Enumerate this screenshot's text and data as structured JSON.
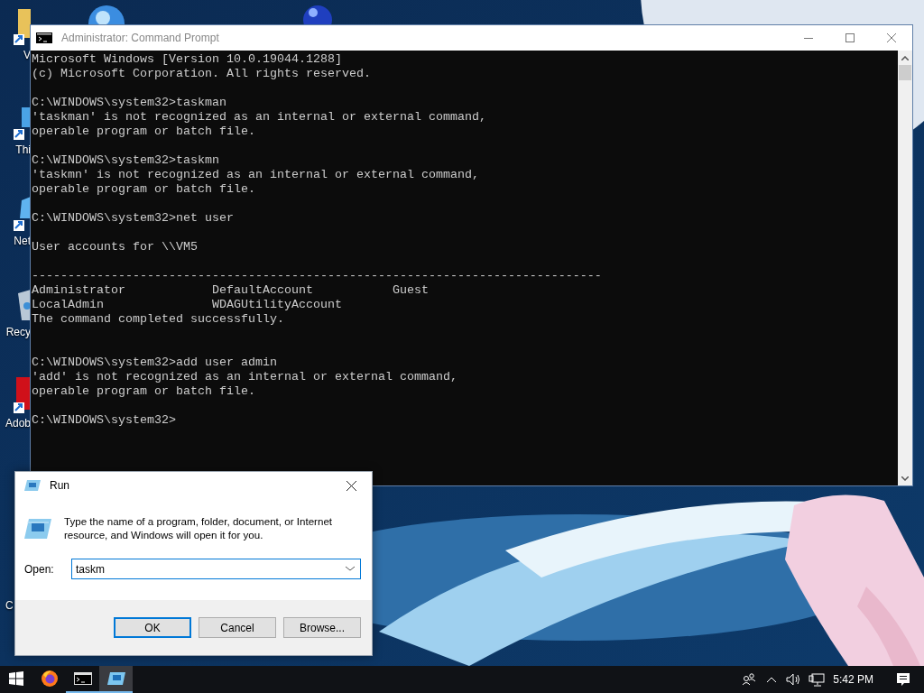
{
  "desktop_icons": [
    {
      "label": "V"
    },
    {
      "label": "Thi"
    },
    {
      "label": "Net"
    },
    {
      "label": "Recy"
    },
    {
      "label": "Adob"
    },
    {
      "label": "C"
    }
  ],
  "console_window": {
    "title": "Administrator: Command Prompt",
    "lines": [
      {
        "kind": "text",
        "text": "Microsoft Windows [Version 10.0.19044.1288]"
      },
      {
        "kind": "text",
        "text": "(c) Microsoft Corporation. All rights reserved."
      },
      {
        "kind": "blank"
      },
      {
        "kind": "text",
        "text": "C:\\WINDOWS\\system32>taskman"
      },
      {
        "kind": "text",
        "text": "'taskman' is not recognized as an internal or external command,"
      },
      {
        "kind": "text",
        "text": "operable program or batch file."
      },
      {
        "kind": "blank"
      },
      {
        "kind": "text",
        "text": "C:\\WINDOWS\\system32>taskmn"
      },
      {
        "kind": "text",
        "text": "'taskmn' is not recognized as an internal or external command,"
      },
      {
        "kind": "text",
        "text": "operable program or batch file."
      },
      {
        "kind": "blank"
      },
      {
        "kind": "text",
        "text": "C:\\WINDOWS\\system32>net user"
      },
      {
        "kind": "blank"
      },
      {
        "kind": "text",
        "text": "User accounts for \\\\VM5"
      },
      {
        "kind": "blank"
      },
      {
        "kind": "text",
        "text": "-------------------------------------------------------------------------------"
      },
      {
        "kind": "text",
        "text": "Administrator            DefaultAccount           Guest"
      },
      {
        "kind": "text",
        "text": "LocalAdmin               WDAGUtilityAccount"
      },
      {
        "kind": "text",
        "text": "The command completed successfully."
      },
      {
        "kind": "blank"
      },
      {
        "kind": "blank"
      },
      {
        "kind": "text",
        "text": "C:\\WINDOWS\\system32>add user admin"
      },
      {
        "kind": "text",
        "text": "'add' is not recognized as an internal or external command,"
      },
      {
        "kind": "text",
        "text": "operable program or batch file."
      },
      {
        "kind": "blank"
      },
      {
        "kind": "text",
        "text": "C:\\WINDOWS\\system32>"
      }
    ]
  },
  "run_dialog": {
    "title": "Run",
    "description": "Type the name of a program, folder, document, or Internet resource, and Windows will open it for you.",
    "open_label": "Open:",
    "open_value": "taskm",
    "buttons": [
      {
        "label": "OK",
        "default": true
      },
      {
        "label": "Cancel",
        "default": false
      },
      {
        "label": "Browse...",
        "default": false
      }
    ]
  },
  "taskbar": {
    "apps": [
      {
        "open": false,
        "active": false
      },
      {
        "open": false,
        "active": false
      },
      {
        "open": true,
        "active": false
      },
      {
        "open": true,
        "active": true
      }
    ],
    "clock": "5:42 PM"
  }
}
